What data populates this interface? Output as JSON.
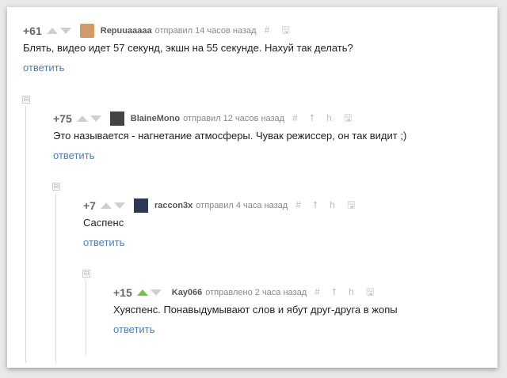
{
  "comments": [
    {
      "rating": "+61",
      "author": "Repuuaaaaa",
      "meta": "отправил 14 часов назад",
      "text": "Блять, видео идет 57 секунд, экшн на 55 секунде. Нахуй так делать?",
      "reply": "ответить",
      "tools": "# 🖫",
      "avatar_color": "#d09a6b",
      "upvoted": false
    },
    {
      "rating": "+75",
      "author": "BlaineMono",
      "meta": "отправил 12 часов назад",
      "text": "Это называется - нагнетание атмосферы. Чувак режиссер, он так видит ;)",
      "reply": "ответить",
      "tools": "# ⭡ h 🖫",
      "avatar_color": "#444444",
      "upvoted": false
    },
    {
      "rating": "+7",
      "author": "raccon3x",
      "meta": "отправил 4 часа назад",
      "text": "Саспенс",
      "reply": "ответить",
      "tools": "# ⭡ h 🖫",
      "avatar_color": "#2a3a55",
      "upvoted": false
    },
    {
      "rating": "+15",
      "author": "Kay066",
      "meta": "отправлено 2 часа назад",
      "text": "Хуяспенс. Понавыдумывают слов и ябут друг-друга в жопы",
      "reply": "ответить",
      "tools": "# ⭡ h 🖫",
      "avatar_color": "",
      "upvoted": true
    }
  ],
  "collapse_symbol": "⊟"
}
